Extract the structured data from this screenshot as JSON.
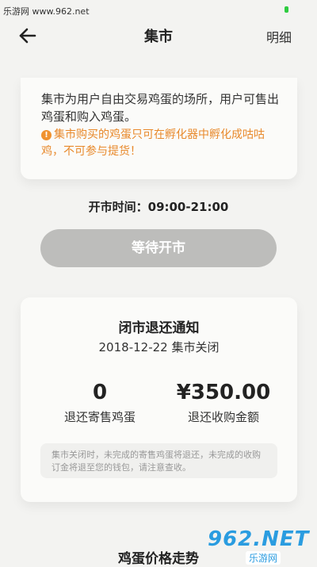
{
  "watermark": "乐游网 www.962.net",
  "nav": {
    "title": "集市",
    "detail": "明细"
  },
  "intro": {
    "text": "集市为用户自由交易鸡蛋的场所，用户可售出鸡蛋和购入鸡蛋。",
    "warning": "集市购买的鸡蛋只可在孵化器中孵化成咕咕鸡，不可参与提货！"
  },
  "market": {
    "hours": "开市时间：09:00-21:00",
    "wait_button": "等待开市"
  },
  "notice": {
    "title": "闭市退还通知",
    "date_status": "2018-12-22 集市关闭",
    "refund_count": "0",
    "refund_count_label": "退还寄售鸡蛋",
    "refund_amount": "¥350.00",
    "refund_amount_label": "退还收购金额",
    "note": "集市关闭时，未完成的寄售鸡蛋将退还，未完成的收购订金将退至您的钱包，请注意查收。"
  },
  "trend_title": "鸡蛋价格走势",
  "logo": {
    "main": "962.NET",
    "sub": "乐游网"
  },
  "colors": {
    "warning": "#e8892b",
    "disabled_button": "#bdbdbb",
    "logo": "#2a9ce0"
  }
}
